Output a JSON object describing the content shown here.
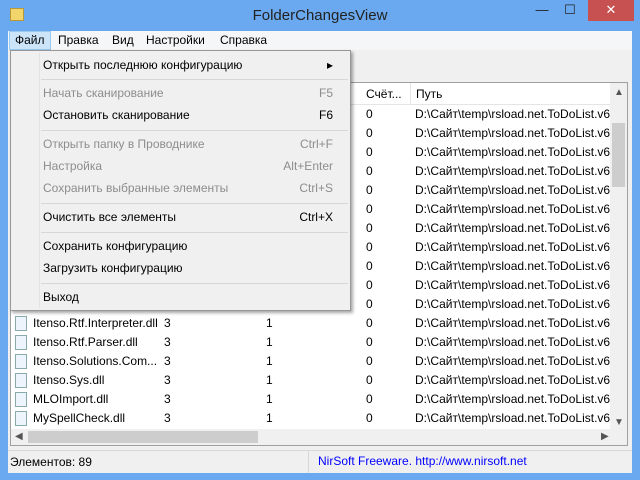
{
  "window": {
    "title": "FolderChangesView",
    "minimize": "—",
    "maximize": "☐",
    "close": "✕"
  },
  "menubar": [
    "Файл",
    "Правка",
    "Вид",
    "Настройки",
    "Справка"
  ],
  "file_menu": [
    {
      "label": "Открыть последнюю конфигурацию",
      "shortcut": "▸",
      "disabled": false
    },
    {
      "label": "Начать сканирование",
      "shortcut": "F5",
      "disabled": true
    },
    {
      "label": "Остановить сканирование",
      "shortcut": "F6",
      "disabled": false
    },
    {
      "label": "Открыть папку в Проводнике",
      "shortcut": "Ctrl+F",
      "disabled": true
    },
    {
      "label": "Настройка",
      "shortcut": "Alt+Enter",
      "disabled": true
    },
    {
      "label": "Сохранить выбранные элементы",
      "shortcut": "Ctrl+S",
      "disabled": true
    },
    {
      "label": "Очистить все элементы",
      "shortcut": "Ctrl+X",
      "disabled": false
    },
    {
      "label": "Сохранить конфигурацию",
      "shortcut": "",
      "disabled": false
    },
    {
      "label": "Загрузить конфигурацию",
      "shortcut": "",
      "disabled": false
    },
    {
      "label": "Выход",
      "shortcut": "",
      "disabled": false
    }
  ],
  "columns": {
    "count": "Счёт...",
    "path": "Путь"
  },
  "rows": [
    {
      "name": "",
      "c2": "",
      "c3": "",
      "c4": "0",
      "path": "D:\\Сайт\\temp\\rsload.net.ToDoList.v6."
    },
    {
      "name": "",
      "c2": "",
      "c3": "",
      "c4": "0",
      "path": "D:\\Сайт\\temp\\rsload.net.ToDoList.v6."
    },
    {
      "name": "",
      "c2": "",
      "c3": "",
      "c4": "0",
      "path": "D:\\Сайт\\temp\\rsload.net.ToDoList.v6."
    },
    {
      "name": "",
      "c2": "",
      "c3": "",
      "c4": "0",
      "path": "D:\\Сайт\\temp\\rsload.net.ToDoList.v6."
    },
    {
      "name": "",
      "c2": "",
      "c3": "",
      "c4": "0",
      "path": "D:\\Сайт\\temp\\rsload.net.ToDoList.v6."
    },
    {
      "name": "",
      "c2": "",
      "c3": "",
      "c4": "0",
      "path": "D:\\Сайт\\temp\\rsload.net.ToDoList.v6."
    },
    {
      "name": "",
      "c2": "",
      "c3": "",
      "c4": "0",
      "path": "D:\\Сайт\\temp\\rsload.net.ToDoList.v6."
    },
    {
      "name": "",
      "c2": "",
      "c3": "",
      "c4": "0",
      "path": "D:\\Сайт\\temp\\rsload.net.ToDoList.v6."
    },
    {
      "name": "",
      "c2": "",
      "c3": "",
      "c4": "0",
      "path": "D:\\Сайт\\temp\\rsload.net.ToDoList.v6."
    },
    {
      "name": "",
      "c2": "",
      "c3": "",
      "c4": "0",
      "path": "D:\\Сайт\\temp\\rsload.net.ToDoList.v6."
    },
    {
      "name": "",
      "c2": "",
      "c3": "",
      "c4": "0",
      "path": "D:\\Сайт\\temp\\rsload.net.ToDoList.v6."
    },
    {
      "name": "Itenso.Rtf.Interpreter.dll",
      "c2": "3",
      "c3": "1",
      "c4": "0",
      "path": "D:\\Сайт\\temp\\rsload.net.ToDoList.v6."
    },
    {
      "name": "Itenso.Rtf.Parser.dll",
      "c2": "3",
      "c3": "1",
      "c4": "0",
      "path": "D:\\Сайт\\temp\\rsload.net.ToDoList.v6."
    },
    {
      "name": "Itenso.Solutions.Com...",
      "c2": "3",
      "c3": "1",
      "c4": "0",
      "path": "D:\\Сайт\\temp\\rsload.net.ToDoList.v6."
    },
    {
      "name": "Itenso.Sys.dll",
      "c2": "3",
      "c3": "1",
      "c4": "0",
      "path": "D:\\Сайт\\temp\\rsload.net.ToDoList.v6."
    },
    {
      "name": "MLOImport.dll",
      "c2": "3",
      "c3": "1",
      "c4": "0",
      "path": "D:\\Сайт\\temp\\rsload.net.ToDoList.v6."
    },
    {
      "name": "MySpellCheck.dll",
      "c2": "3",
      "c3": "1",
      "c4": "0",
      "path": "D:\\Сайт\\temp\\rsload.net.ToDoList.v6."
    }
  ],
  "status": {
    "items": "Элементов: 89",
    "credit": "NirSoft Freeware.  http://www.nirsoft.net"
  },
  "colors": {
    "titlebar": "#6aa9f0",
    "close": "#c75050",
    "link": "#0000ff"
  }
}
